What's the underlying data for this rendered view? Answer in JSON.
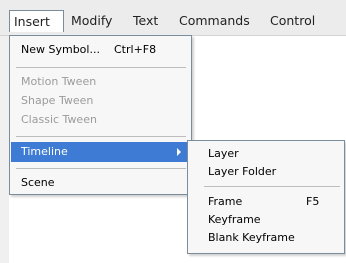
{
  "menubar": {
    "items": [
      "Insert",
      "Modify",
      "Text",
      "Commands",
      "Control"
    ]
  },
  "insert_menu": {
    "new_symbol": {
      "label": "New Symbol...",
      "shortcut": "Ctrl+F8"
    },
    "motion_tween": "Motion Tween",
    "shape_tween": "Shape Tween",
    "classic_tween": "Classic Tween",
    "timeline": "Timeline",
    "scene": "Scene"
  },
  "timeline_submenu": {
    "layer": "Layer",
    "layer_folder": "Layer Folder",
    "frame": {
      "label": "Frame",
      "shortcut": "F5"
    },
    "keyframe": "Keyframe",
    "blank_keyframe": "Blank Keyframe"
  },
  "colors": {
    "highlight": "#3e7bd4",
    "disabled_text": "#9b9b9b",
    "menu_border": "#7b8c9a"
  }
}
